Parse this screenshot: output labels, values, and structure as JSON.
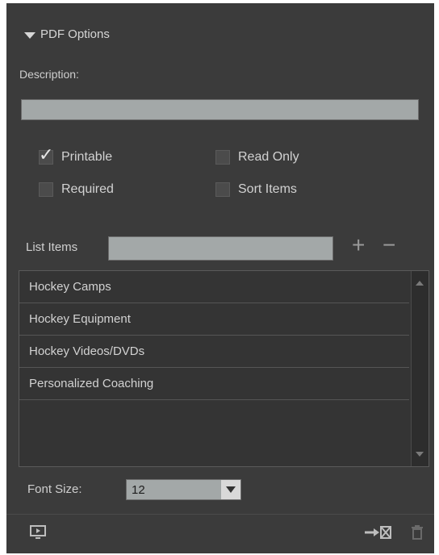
{
  "panel": {
    "title": "PDF Options",
    "description_label": "Description:",
    "description_value": "",
    "checkboxes": [
      {
        "label": "Printable",
        "checked": true
      },
      {
        "label": "Read Only",
        "checked": false
      },
      {
        "label": "Required",
        "checked": false
      },
      {
        "label": "Sort Items",
        "checked": false
      }
    ],
    "list_items_label": "List Items",
    "list_items_input": "",
    "add_symbol": "+",
    "remove_symbol": "−",
    "items": [
      "Hockey Camps",
      "Hockey Equipment",
      "Hockey Videos/DVDs",
      "Personalized Coaching"
    ],
    "font_size_label": "Font Size:",
    "font_size_value": "12"
  },
  "icons": {
    "preview": "monitor-icon",
    "convert": "export-to-field-icon",
    "delete": "trash-icon"
  }
}
